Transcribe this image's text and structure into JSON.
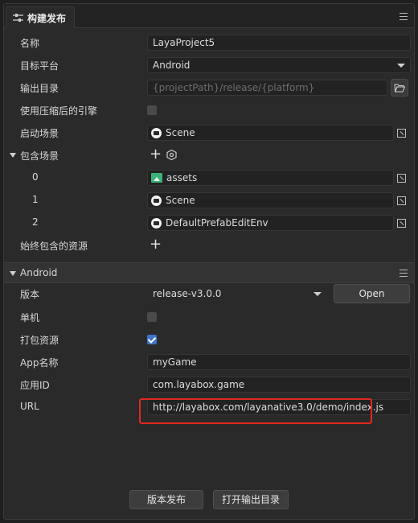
{
  "window": {
    "title": "构建发布"
  },
  "colors": {
    "accent": "#3e74c9",
    "highlight": "#e0271f",
    "folder": "#3bb37a"
  },
  "icons": {
    "tab": "sliders-icon",
    "menu": "hamburger-menu-icon",
    "folder": "folder-open-icon",
    "scene": "scene-icon",
    "assets": "folder-image-icon",
    "pick": "pick-target-icon",
    "add": "plus-icon",
    "settings": "gear-icon"
  },
  "fields": {
    "name": {
      "label": "名称",
      "value": "LayaProject5"
    },
    "target_platform": {
      "label": "目标平台",
      "value": "Android"
    },
    "output_dir": {
      "label": "输出目录",
      "placeholder": "{projectPath}/release/{platform}"
    },
    "compressed_engine": {
      "label": "使用压缩后的引擎",
      "checked": false
    },
    "startup_scene": {
      "label": "启动场景",
      "value": "Scene"
    },
    "included_scenes": {
      "label": "包含场景",
      "items": [
        {
          "index": "0",
          "value": "assets"
        },
        {
          "index": "1",
          "value": "Scene"
        },
        {
          "index": "2",
          "value": "DefaultPrefabEditEnv"
        }
      ]
    },
    "always_include": {
      "label": "始终包含的资源"
    }
  },
  "android": {
    "section_title": "Android",
    "version": {
      "label": "版本",
      "value": "release-v3.0.0",
      "open_label": "Open"
    },
    "standalone": {
      "label": "单机",
      "checked": false
    },
    "pack_resources": {
      "label": "打包资源",
      "checked": true
    },
    "app_name": {
      "label": "App名称",
      "value": "myGame"
    },
    "app_id": {
      "label": "应用ID",
      "value": "com.layabox.game"
    },
    "url": {
      "label": "URL",
      "value": "http://layabox.com/layanative3.0/demo/index.js"
    }
  },
  "footer": {
    "publish_label": "版本发布",
    "open_output_label": "打开输出目录"
  }
}
